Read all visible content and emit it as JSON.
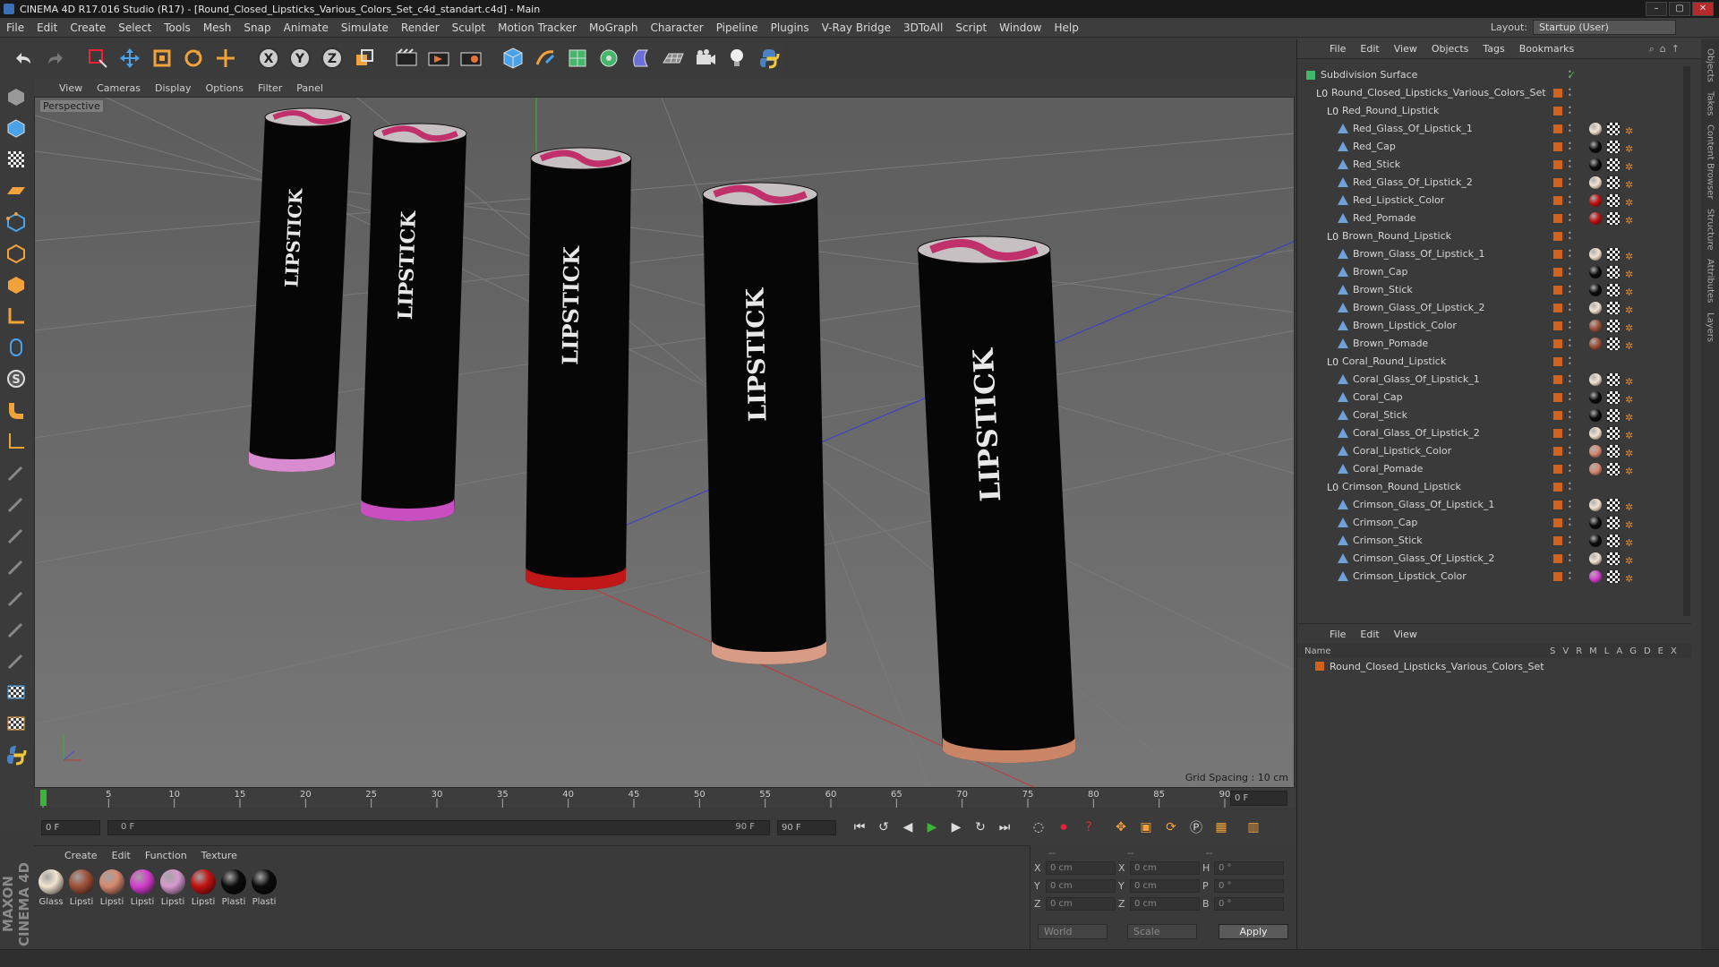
{
  "titlebar": {
    "title": "CINEMA 4D R17.016 Studio (R17) - [Round_Closed_Lipsticks_Various_Colors_Set_c4d_standart.c4d] - Main"
  },
  "menubar": [
    "File",
    "Edit",
    "Create",
    "Select",
    "Tools",
    "Mesh",
    "Snap",
    "Animate",
    "Simulate",
    "Render",
    "Sculpt",
    "Motion Tracker",
    "MoGraph",
    "Character",
    "Pipeline",
    "Plugins",
    "V-Ray Bridge",
    "3DToAll",
    "Script",
    "Window",
    "Help"
  ],
  "layout": {
    "label": "Layout:",
    "value": "Startup (User)"
  },
  "viewport": {
    "menu": [
      "View",
      "Cameras",
      "Display",
      "Options",
      "Filter",
      "Panel"
    ],
    "camera_label": "Perspective",
    "grid_spacing": "Grid Spacing : 10 cm",
    "lipstick_text": "LIPSTICK",
    "base_colors": [
      "#d98bd0",
      "#c94fc0",
      "#c01818",
      "#d89b85",
      "#c98566"
    ]
  },
  "timeline": {
    "ticks": [
      "0",
      "5",
      "10",
      "15",
      "20",
      "25",
      "30",
      "35",
      "40",
      "45",
      "50",
      "55",
      "60",
      "65",
      "70",
      "75",
      "80",
      "85",
      "90"
    ],
    "end_field": "0 F"
  },
  "transport": {
    "start": "0 F",
    "range_start": "0 F",
    "range_end": "90 F",
    "end": "90 F"
  },
  "materials": {
    "menu": [
      "Create",
      "Edit",
      "Function",
      "Texture"
    ],
    "items": [
      {
        "label": "Glass",
        "color": "#f3e4d2"
      },
      {
        "label": "Lipsti",
        "color": "#a0523a"
      },
      {
        "label": "Lipsti",
        "color": "#d88a70"
      },
      {
        "label": "Lipsti",
        "color": "#d63fd0"
      },
      {
        "label": "Lipsti",
        "color": "#d79ad0"
      },
      {
        "label": "Lipsti",
        "color": "#c31212"
      },
      {
        "label": "Plasti",
        "color": "#0c0c0c"
      },
      {
        "label": "Plasti",
        "color": "#0c0c0c"
      }
    ]
  },
  "coords": {
    "header": [
      "--",
      "--",
      "--"
    ],
    "rows": [
      {
        "a1": "X",
        "v1": "0 cm",
        "a2": "X",
        "v2": "0 cm",
        "a3": "H",
        "v3": "0 °"
      },
      {
        "a1": "Y",
        "v1": "0 cm",
        "a2": "Y",
        "v2": "0 cm",
        "a3": "P",
        "v3": "0 °"
      },
      {
        "a1": "Z",
        "v1": "0 cm",
        "a2": "Z",
        "v2": "0 cm",
        "a3": "B",
        "v3": "0 °"
      }
    ],
    "world": "World",
    "scale": "Scale",
    "apply": "Apply"
  },
  "objects": {
    "menu": [
      "File",
      "Edit",
      "View",
      "Objects",
      "Tags",
      "Bookmarks"
    ],
    "rows": [
      {
        "name": "Subdivision Surface",
        "level": 0,
        "type": "subd"
      },
      {
        "name": "Round_Closed_Lipsticks_Various_Colors_Set",
        "level": 1,
        "type": "null"
      },
      {
        "name": "Red_Round_Lipstick",
        "level": 2,
        "type": "null"
      },
      {
        "name": "Red_Glass_Of_Lipstick_1",
        "level": 3,
        "type": "obj",
        "mat": "#f3e4d2"
      },
      {
        "name": "Red_Cap",
        "level": 3,
        "type": "obj",
        "mat": "#0c0c0c"
      },
      {
        "name": "Red_Stick",
        "level": 3,
        "type": "obj",
        "mat": "#0c0c0c"
      },
      {
        "name": "Red_Glass_Of_Lipstick_2",
        "level": 3,
        "type": "obj",
        "mat": "#f3e4d2"
      },
      {
        "name": "Red_Lipstick_Color",
        "level": 3,
        "type": "obj",
        "mat": "#c31212"
      },
      {
        "name": "Red_Pomade",
        "level": 3,
        "type": "obj",
        "mat": "#c31212"
      },
      {
        "name": "Brown_Round_Lipstick",
        "level": 2,
        "type": "null"
      },
      {
        "name": "Brown_Glass_Of_Lipstick_1",
        "level": 3,
        "type": "obj",
        "mat": "#f3e4d2"
      },
      {
        "name": "Brown_Cap",
        "level": 3,
        "type": "obj",
        "mat": "#0c0c0c"
      },
      {
        "name": "Brown_Stick",
        "level": 3,
        "type": "obj",
        "mat": "#0c0c0c"
      },
      {
        "name": "Brown_Glass_Of_Lipstick_2",
        "level": 3,
        "type": "obj",
        "mat": "#f3e4d2"
      },
      {
        "name": "Brown_Lipstick_Color",
        "level": 3,
        "type": "obj",
        "mat": "#a0523a"
      },
      {
        "name": "Brown_Pomade",
        "level": 3,
        "type": "obj",
        "mat": "#a0523a"
      },
      {
        "name": "Coral_Round_Lipstick",
        "level": 2,
        "type": "null"
      },
      {
        "name": "Coral_Glass_Of_Lipstick_1",
        "level": 3,
        "type": "obj",
        "mat": "#f3e4d2"
      },
      {
        "name": "Coral_Cap",
        "level": 3,
        "type": "obj",
        "mat": "#0c0c0c"
      },
      {
        "name": "Coral_Stick",
        "level": 3,
        "type": "obj",
        "mat": "#0c0c0c"
      },
      {
        "name": "Coral_Glass_Of_Lipstick_2",
        "level": 3,
        "type": "obj",
        "mat": "#f3e4d2"
      },
      {
        "name": "Coral_Lipstick_Color",
        "level": 3,
        "type": "obj",
        "mat": "#d88a70"
      },
      {
        "name": "Coral_Pomade",
        "level": 3,
        "type": "obj",
        "mat": "#d88a70"
      },
      {
        "name": "Crimson_Round_Lipstick",
        "level": 2,
        "type": "null"
      },
      {
        "name": "Crimson_Glass_Of_Lipstick_1",
        "level": 3,
        "type": "obj",
        "mat": "#f3e4d2"
      },
      {
        "name": "Crimson_Cap",
        "level": 3,
        "type": "obj",
        "mat": "#0c0c0c"
      },
      {
        "name": "Crimson_Stick",
        "level": 3,
        "type": "obj",
        "mat": "#0c0c0c"
      },
      {
        "name": "Crimson_Glass_Of_Lipstick_2",
        "level": 3,
        "type": "obj",
        "mat": "#f3e4d2"
      },
      {
        "name": "Crimson_Lipstick_Color",
        "level": 3,
        "type": "obj",
        "mat": "#d63fd0"
      }
    ]
  },
  "layers": {
    "menu": [
      "File",
      "Edit",
      "View"
    ],
    "header": {
      "name": "Name",
      "cols": [
        "S",
        "V",
        "R",
        "M",
        "L",
        "A",
        "G",
        "D",
        "E",
        "X"
      ]
    },
    "rows": [
      {
        "name": "Round_Closed_Lipsticks_Various_Colors_Set",
        "color": "#d0641f"
      }
    ]
  },
  "side_tabs": [
    "Objects",
    "Takes",
    "Content Browser",
    "Structure",
    "Attributes",
    "Layers"
  ],
  "logo": "MAXON CINEMA 4D"
}
